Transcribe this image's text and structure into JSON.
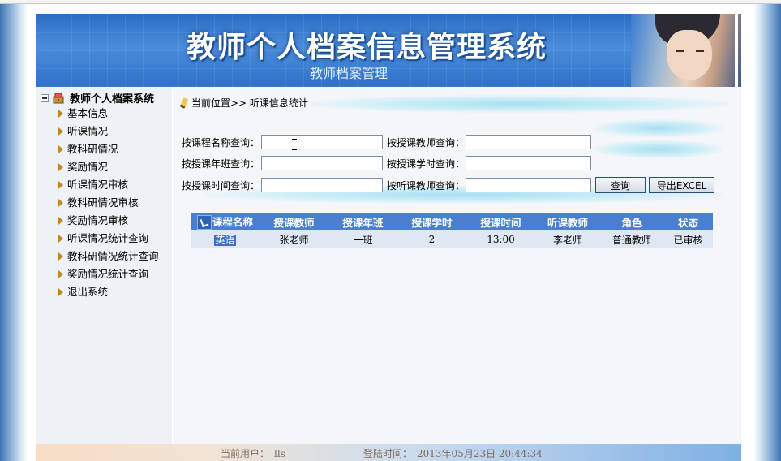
{
  "header": {
    "title": "教师个人档案信息管理系统",
    "subtitle": "教师档案管理"
  },
  "sidebar": {
    "root_label": "教师个人档案系统",
    "items": [
      {
        "label": "基本信息"
      },
      {
        "label": "听课情况"
      },
      {
        "label": "教科研情况"
      },
      {
        "label": "奖励情况"
      },
      {
        "label": "听课情况审核"
      },
      {
        "label": "教科研情况审核"
      },
      {
        "label": "奖励情况审核"
      },
      {
        "label": "听课情况统计查询"
      },
      {
        "label": "教科研情况统计查询"
      },
      {
        "label": "奖励情况统计查询"
      },
      {
        "label": "退出系统"
      }
    ]
  },
  "breadcrumb": "当前位置>> 听课信息统计",
  "search": {
    "course_name_label": "按课程名称查询：",
    "teacher_label": "按授课教师查询：",
    "class_label": "按授课年班查询：",
    "hours_label": "按授课学时查询：",
    "time_label": "按授课时间查询：",
    "listener_label": "按听课教师查询：",
    "course_name_value": "",
    "teacher_value": "",
    "class_value": "",
    "hours_value": "",
    "time_value": "",
    "listener_value": "",
    "query_button": "查询",
    "export_button": "导出EXCEL"
  },
  "table": {
    "headers": [
      "课程名称",
      "授课教师",
      "授课年班",
      "授课学时",
      "授课时间",
      "听课教师",
      "角色",
      "状态"
    ],
    "rows": [
      [
        "英语",
        "张老师",
        "一班",
        "2",
        "13:00",
        "李老师",
        "普通教师",
        "已审核"
      ]
    ]
  },
  "footer": {
    "user_label": "当前用户：",
    "user_value": "lls",
    "login_label": "登陆时间：",
    "login_value": "2013年05月23日  20:44:34"
  },
  "colors": {
    "banner": "#2f72c8",
    "table_header": "#4a7fd0",
    "table_row": "#dfe8f2"
  }
}
